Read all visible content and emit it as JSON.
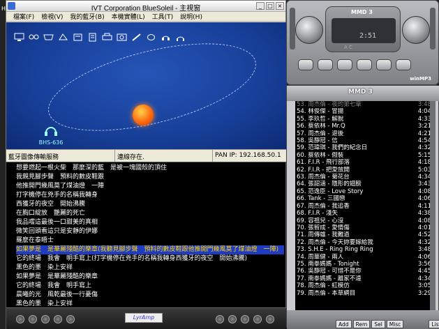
{
  "desktop": {
    "corner_letter": "H"
  },
  "bluesoleil": {
    "title": "IVT Corporation BlueSoleil - 主視窗",
    "window_buttons": [
      "_",
      "□",
      "×"
    ],
    "menu": [
      "檔案(F)",
      "檢視(V)",
      "我的藍牙(B)",
      "本機實體(L)",
      "工具(T)",
      "說明(H)"
    ],
    "device_label": "BHS-636",
    "status": {
      "service": "藍牙圖像傳輸服務",
      "connection": "連線存在.",
      "pan_ip": "PAN IP: 192.168.50.1"
    }
  },
  "lyrics": {
    "lines": [
      "想要燃起一根火柴　那麼深的藍　是被一塊國殼的頂住",
      "我親見腳步聲　預料的數皮鞋跟",
      "他推開門幾風莫了煤油燈　一陣",
      "打字機停在兇手的名稱我轉身",
      "西獲牙的夜空　開始沸騰",
      "在胸口綻放　艷麗的死亡",
      "我品嚐這最後一口甜美的真相",
      "微笑回頭看這只是安靜的伊娜",
      "羅麼在泰晤士",
      "如果夢是　是華麗殘酷的樂章(我聽見腳步聲　預料的數皮鞋跟他推開門幾風莫了煤油燈　一陣)",
      "它的終場　我會　明手寫上(打字機停在兇手的名稱我轉身西獲牙的夜空　開始沸騰)",
      "黑色的墨　染上安祥",
      "如果夢是　是華麗殘酷的樂章",
      "它的終場　我會　明手寫上",
      "晨曦的光　風乾最後一行憂傷",
      "黑色的墨　染上安祥"
    ],
    "highlight_index": 9,
    "logo": "LyrAmp"
  },
  "player": {
    "brand": "MMD 3",
    "time": "2:51",
    "ac_label": "A  C",
    "mp3_badge": "winMP3"
  },
  "playlist": {
    "brand": "MMD 3",
    "tracks": [
      {
        "t": "53. 周杰倫 - 夜的第七章",
        "d": "3:48"
      },
      {
        "t": "54. 林俊傑 - 冒揚",
        "d": "4:04"
      },
      {
        "t": "55. 李玖哲 - 解脫",
        "d": "4:33"
      },
      {
        "t": "56. 蔡依林 - Mr.Q",
        "d": "3:21"
      },
      {
        "t": "57. 周杰倫 - 退後",
        "d": "4:21"
      },
      {
        "t": "58. 吳靜冠 - 信",
        "d": "4:54"
      },
      {
        "t": "59. 范瑋琪 - 我們的紀念日",
        "d": "4:32"
      },
      {
        "t": "60. 蔡依林 - 假裝",
        "d": "5:15"
      },
      {
        "t": "61. F.I.R - 飛行部落",
        "d": "4:18"
      },
      {
        "t": "62. F.I.R - 把愛放開",
        "d": "5:03"
      },
      {
        "t": "63. 周杰倫 - 菊花台",
        "d": "4:34"
      },
      {
        "t": "64. 張韶涵 - 隱形的翅膀",
        "d": "3:43"
      },
      {
        "t": "65. 范逸臣 - Love Story",
        "d": "4:08"
      },
      {
        "t": "66. Tank - 三國戀",
        "d": "4:06"
      },
      {
        "t": "67. 周杰倫 - 我追香",
        "d": "4:11"
      },
      {
        "t": "68. F.I.R - 淺失",
        "d": "4:38"
      },
      {
        "t": "69. 容祖兒 - 心沒",
        "d": "4:08"
      },
      {
        "t": "70. 張智成 - 愛情傷",
        "d": "4:01"
      },
      {
        "t": "71. 周傳雄 - 我難過",
        "d": "4:52"
      },
      {
        "t": "72. 周杰倫 - 今天妳要嫁給我",
        "d": "4:32"
      },
      {
        "t": "73. S.H.E - Ring Ring Ring",
        "d": "3:48"
      },
      {
        "t": "74. 周華健 - 兩人",
        "d": "4:06"
      },
      {
        "t": "75. 南拳媽媽 - Tonight",
        "d": "3:56"
      },
      {
        "t": "76. 吳靜冠 - 可惜不是你",
        "d": "4:45"
      },
      {
        "t": "77. 南拳媽媽 - 離家不遠",
        "d": "4:34"
      },
      {
        "t": "78. 周杰倫 - 紅模仿",
        "d": "3:05"
      },
      {
        "t": "79. 周杰倫 - 本草綱目",
        "d": "3:29"
      }
    ],
    "buttons": [
      "Add",
      "Rem",
      "Sel",
      "Misc",
      "List"
    ]
  }
}
